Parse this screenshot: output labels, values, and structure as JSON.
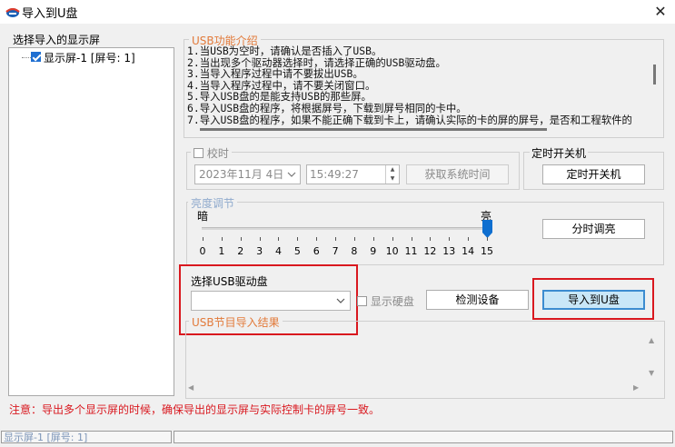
{
  "window": {
    "title": "导入到U盘",
    "close_glyph": "✕"
  },
  "left_panel": {
    "title": "选择导入的显示屏",
    "tree_item": "显示屏-1 [屏号: 1]",
    "tree_item_checked": true
  },
  "usb_intro": {
    "title": "USB功能介绍",
    "lines": [
      "1.当USB为空时，请确认是否插入了USB。",
      "2.当出现多个驱动器选择时，请选择正确的USB驱动盘。",
      "3.当导入程序过程中请不要拔出USB。",
      "4.当导入程序过程中，请不要关闭窗口。",
      "5.导入USB盘的是能支持USB的那些屏。",
      "6.导入USB盘的程序，将根据屏号，下载到屏号相同的卡中。",
      "7.导入USB盘的程序，如果不能正确下载到卡上，请确认实际的卡的屏的屏号，是否和工程软件的"
    ]
  },
  "timing": {
    "checkbox_label": "校时",
    "date_value": "2023年11月 4日",
    "time_value": "15:49:27",
    "get_time_button": "获取系统时间"
  },
  "power": {
    "title": "定时开关机",
    "button": "定时开关机"
  },
  "brightness": {
    "title": "亮度调节",
    "dark_label": "暗",
    "bright_label": "亮",
    "value": 15,
    "ticks": [
      "0",
      "1",
      "2",
      "3",
      "4",
      "5",
      "6",
      "7",
      "8",
      "9",
      "10",
      "11",
      "12",
      "13",
      "14",
      "15"
    ],
    "timed_button": "分时调亮"
  },
  "usb_select": {
    "label": "选择USB驱动盘",
    "selected": "",
    "show_disk_label": "显示硬盘",
    "detect_button": "检测设备",
    "import_button": "导入到U盘"
  },
  "result": {
    "title": "USB节目导入结果"
  },
  "notice": "注意：导出多个显示屏的时候，确保导出的显示屏与实际控制卡的屏号一致。",
  "status_bar": {
    "pane1": "显示屏-1 [屏号: 1]",
    "pane2": ""
  },
  "icons": {
    "dropdown": "chevron-down-icon",
    "spin_up": "▲",
    "spin_down": "▼",
    "scroll_up": "▲",
    "scroll_down": "▼",
    "scroll_left": "◀",
    "scroll_right": "▶"
  },
  "colors": {
    "group_title": "#e27a3a",
    "highlight_box": "#d9181f",
    "primary_button": "#c9e7f8",
    "notice_text": "#d9181f"
  }
}
